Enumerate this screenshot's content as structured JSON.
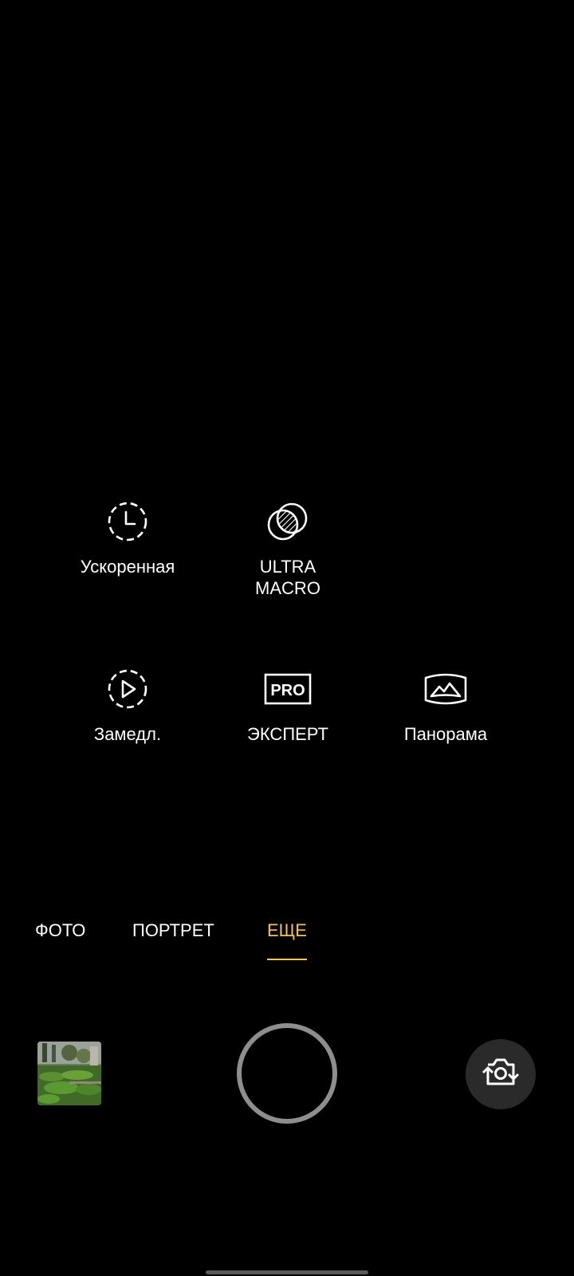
{
  "modes": {
    "timelapse": {
      "label": "Ускоренная",
      "icon": "timelapse-icon"
    },
    "ultra_macro": {
      "label": "ULTRA\nMACRO",
      "icon": "ultra-macro-icon"
    },
    "slowmo": {
      "label": "Замедл.",
      "icon": "slow-motion-icon"
    },
    "expert": {
      "label": "ЭКСПЕРТ",
      "icon": "pro-icon",
      "icon_text": "PRO"
    },
    "panorama": {
      "label": "Панорама",
      "icon": "panorama-icon"
    }
  },
  "tabs": [
    {
      "label": "ФОТО",
      "active": false
    },
    {
      "label": "ПОРТРЕТ",
      "active": false
    },
    {
      "label": "ЕЩЕ",
      "active": true
    }
  ],
  "controls": {
    "gallery_thumbnail": "gallery-thumbnail",
    "shutter": "shutter-button",
    "switch_camera": "switch-camera-icon"
  },
  "colors": {
    "background": "#000000",
    "accent": "#f5c542",
    "shutter_ring": "#8e8e8e",
    "flip_bg": "#2a2a2a"
  }
}
